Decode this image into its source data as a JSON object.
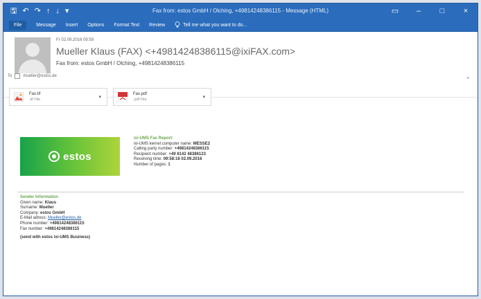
{
  "window": {
    "title": "Fax from: estos GmbH / Olching, +49814248386115 - Message (HTML)",
    "controls": {
      "restore": "▭",
      "minimize": "–",
      "maximize": "□",
      "close": "×"
    }
  },
  "ribbon": {
    "tabs": [
      "File",
      "Message",
      "Insert",
      "Options",
      "Format Text",
      "Review"
    ],
    "tell_me": "Tell me what you want to do..."
  },
  "message": {
    "date": "Fr 02.09.2016 09:59",
    "sender": "Mueller Klaus (FAX) <+49814248386115@ixiFAX.com>",
    "subject": "Fax from: estos GmbH / Olching, +49814248386115",
    "to": "mueller@estos.de",
    "attachments": [
      {
        "name": "Fax.tif",
        "type": ".tif File"
      },
      {
        "name": "Fax.pdf",
        "type": ".pdf File"
      }
    ]
  },
  "content": {
    "logo_text": "estos",
    "report": {
      "title": "ixi-UMS Fax Report:",
      "lines": [
        {
          "label": "ixi-UMS kernel computer name: ",
          "value": "MESSE2"
        },
        {
          "label": "Calling party number: ",
          "value": "+49814248386115"
        },
        {
          "label": "Recipient number: ",
          "value": "+49 8142 48386123"
        },
        {
          "label": "Receiving time: ",
          "value": "09:58:18 02.09.2016"
        },
        {
          "label": "Number of pages: ",
          "value": "1"
        }
      ]
    },
    "sender_info": {
      "title": "Sender Information",
      "lines": [
        {
          "label": "Given name: ",
          "value": "Klaus"
        },
        {
          "label": "Surname: ",
          "value": "Mueller"
        },
        {
          "label": "Company: ",
          "value": "estos GmbH"
        },
        {
          "label": "E-Mail adress: ",
          "value": "Mueller@estos.de"
        },
        {
          "label": "Phone number: ",
          "value": "+49814248386115"
        },
        {
          "label": "Fax number: ",
          "value": "+49814248386115"
        }
      ],
      "sent_with": "(send with estos ixi-UMS Business)"
    }
  },
  "colors": {
    "accent": "#2b6cbc",
    "green_title": "#6aa84f",
    "pdf_red": "#d13438"
  },
  "icons": {
    "save": "save-icon",
    "undo": "undo-icon",
    "redo": "redo-icon",
    "up": "up-arrow-icon",
    "down": "down-arrow-icon",
    "search": "lightbulb-icon",
    "avatar": "avatar-icon",
    "tif_attachment": "image-icon",
    "pdf_attachment": "pdf-icon",
    "chevron": "chevron-down-icon",
    "collapse": "chevron-up-icon"
  }
}
